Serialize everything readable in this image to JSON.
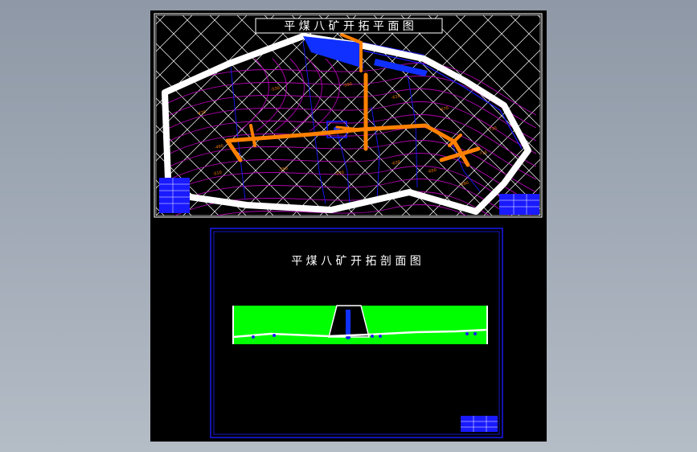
{
  "plan": {
    "title": "平 煤 八 矿 开 拓 平 面 图",
    "contour_labels": [
      "-470",
      "-490",
      "-510",
      "-530",
      "-550",
      "-570",
      "-590",
      "-610",
      "-630",
      "-650",
      "-670",
      "-690",
      "-710",
      "-730"
    ]
  },
  "section": {
    "title": "平 煤 八 矿 开 拓 剖 面 图"
  },
  "colors": {
    "background": "#000000",
    "frame": "#ffffff",
    "contour": "#b000b0",
    "roadway": "#ff8000",
    "shaft": "#1030ff",
    "seam": "#00ff00",
    "section_frame": "#1a1aff"
  }
}
